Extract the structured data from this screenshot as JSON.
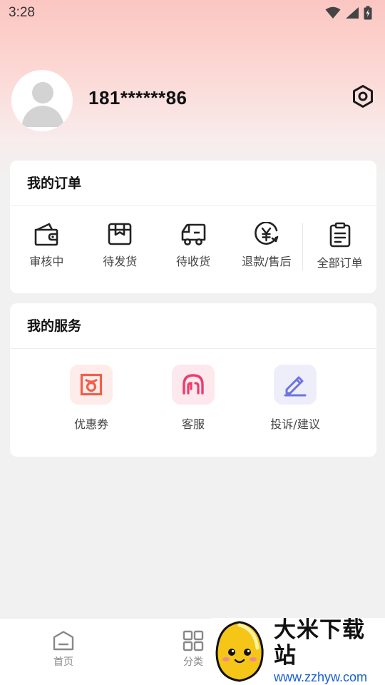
{
  "status_bar": {
    "time": "3:28"
  },
  "profile": {
    "phone": "181******86"
  },
  "orders_card": {
    "title": "我的订单",
    "items": [
      {
        "label": "审核中",
        "icon": "wallet-icon"
      },
      {
        "label": "待发货",
        "icon": "box-icon"
      },
      {
        "label": "待收货",
        "icon": "truck-icon"
      },
      {
        "label": "退款/售后",
        "icon": "refund-yen-icon"
      },
      {
        "label": "全部订单",
        "icon": "clipboard-icon"
      }
    ]
  },
  "services_card": {
    "title": "我的服务",
    "items": [
      {
        "label": "优惠券",
        "icon": "coupon-icon",
        "color": "#f0604c",
        "bg": "#fdecea"
      },
      {
        "label": "客服",
        "icon": "headset-icon",
        "color": "#ee3b6d",
        "bg": "#fde8ee"
      },
      {
        "label": "投诉/建议",
        "icon": "edit-icon",
        "color": "#6c74e0",
        "bg": "#eeeefb"
      }
    ]
  },
  "tab_bar": {
    "tabs": [
      {
        "label": "首页",
        "icon": "home-icon"
      },
      {
        "label": "分类",
        "icon": "grid-icon"
      }
    ]
  },
  "watermark": {
    "title": "大米下载站",
    "url": "www.zzhyw.com"
  },
  "colors": {
    "hero_top": "#fbc6c2",
    "page_bg": "#f1f1f1",
    "watermark_link": "#1a5fd1"
  }
}
